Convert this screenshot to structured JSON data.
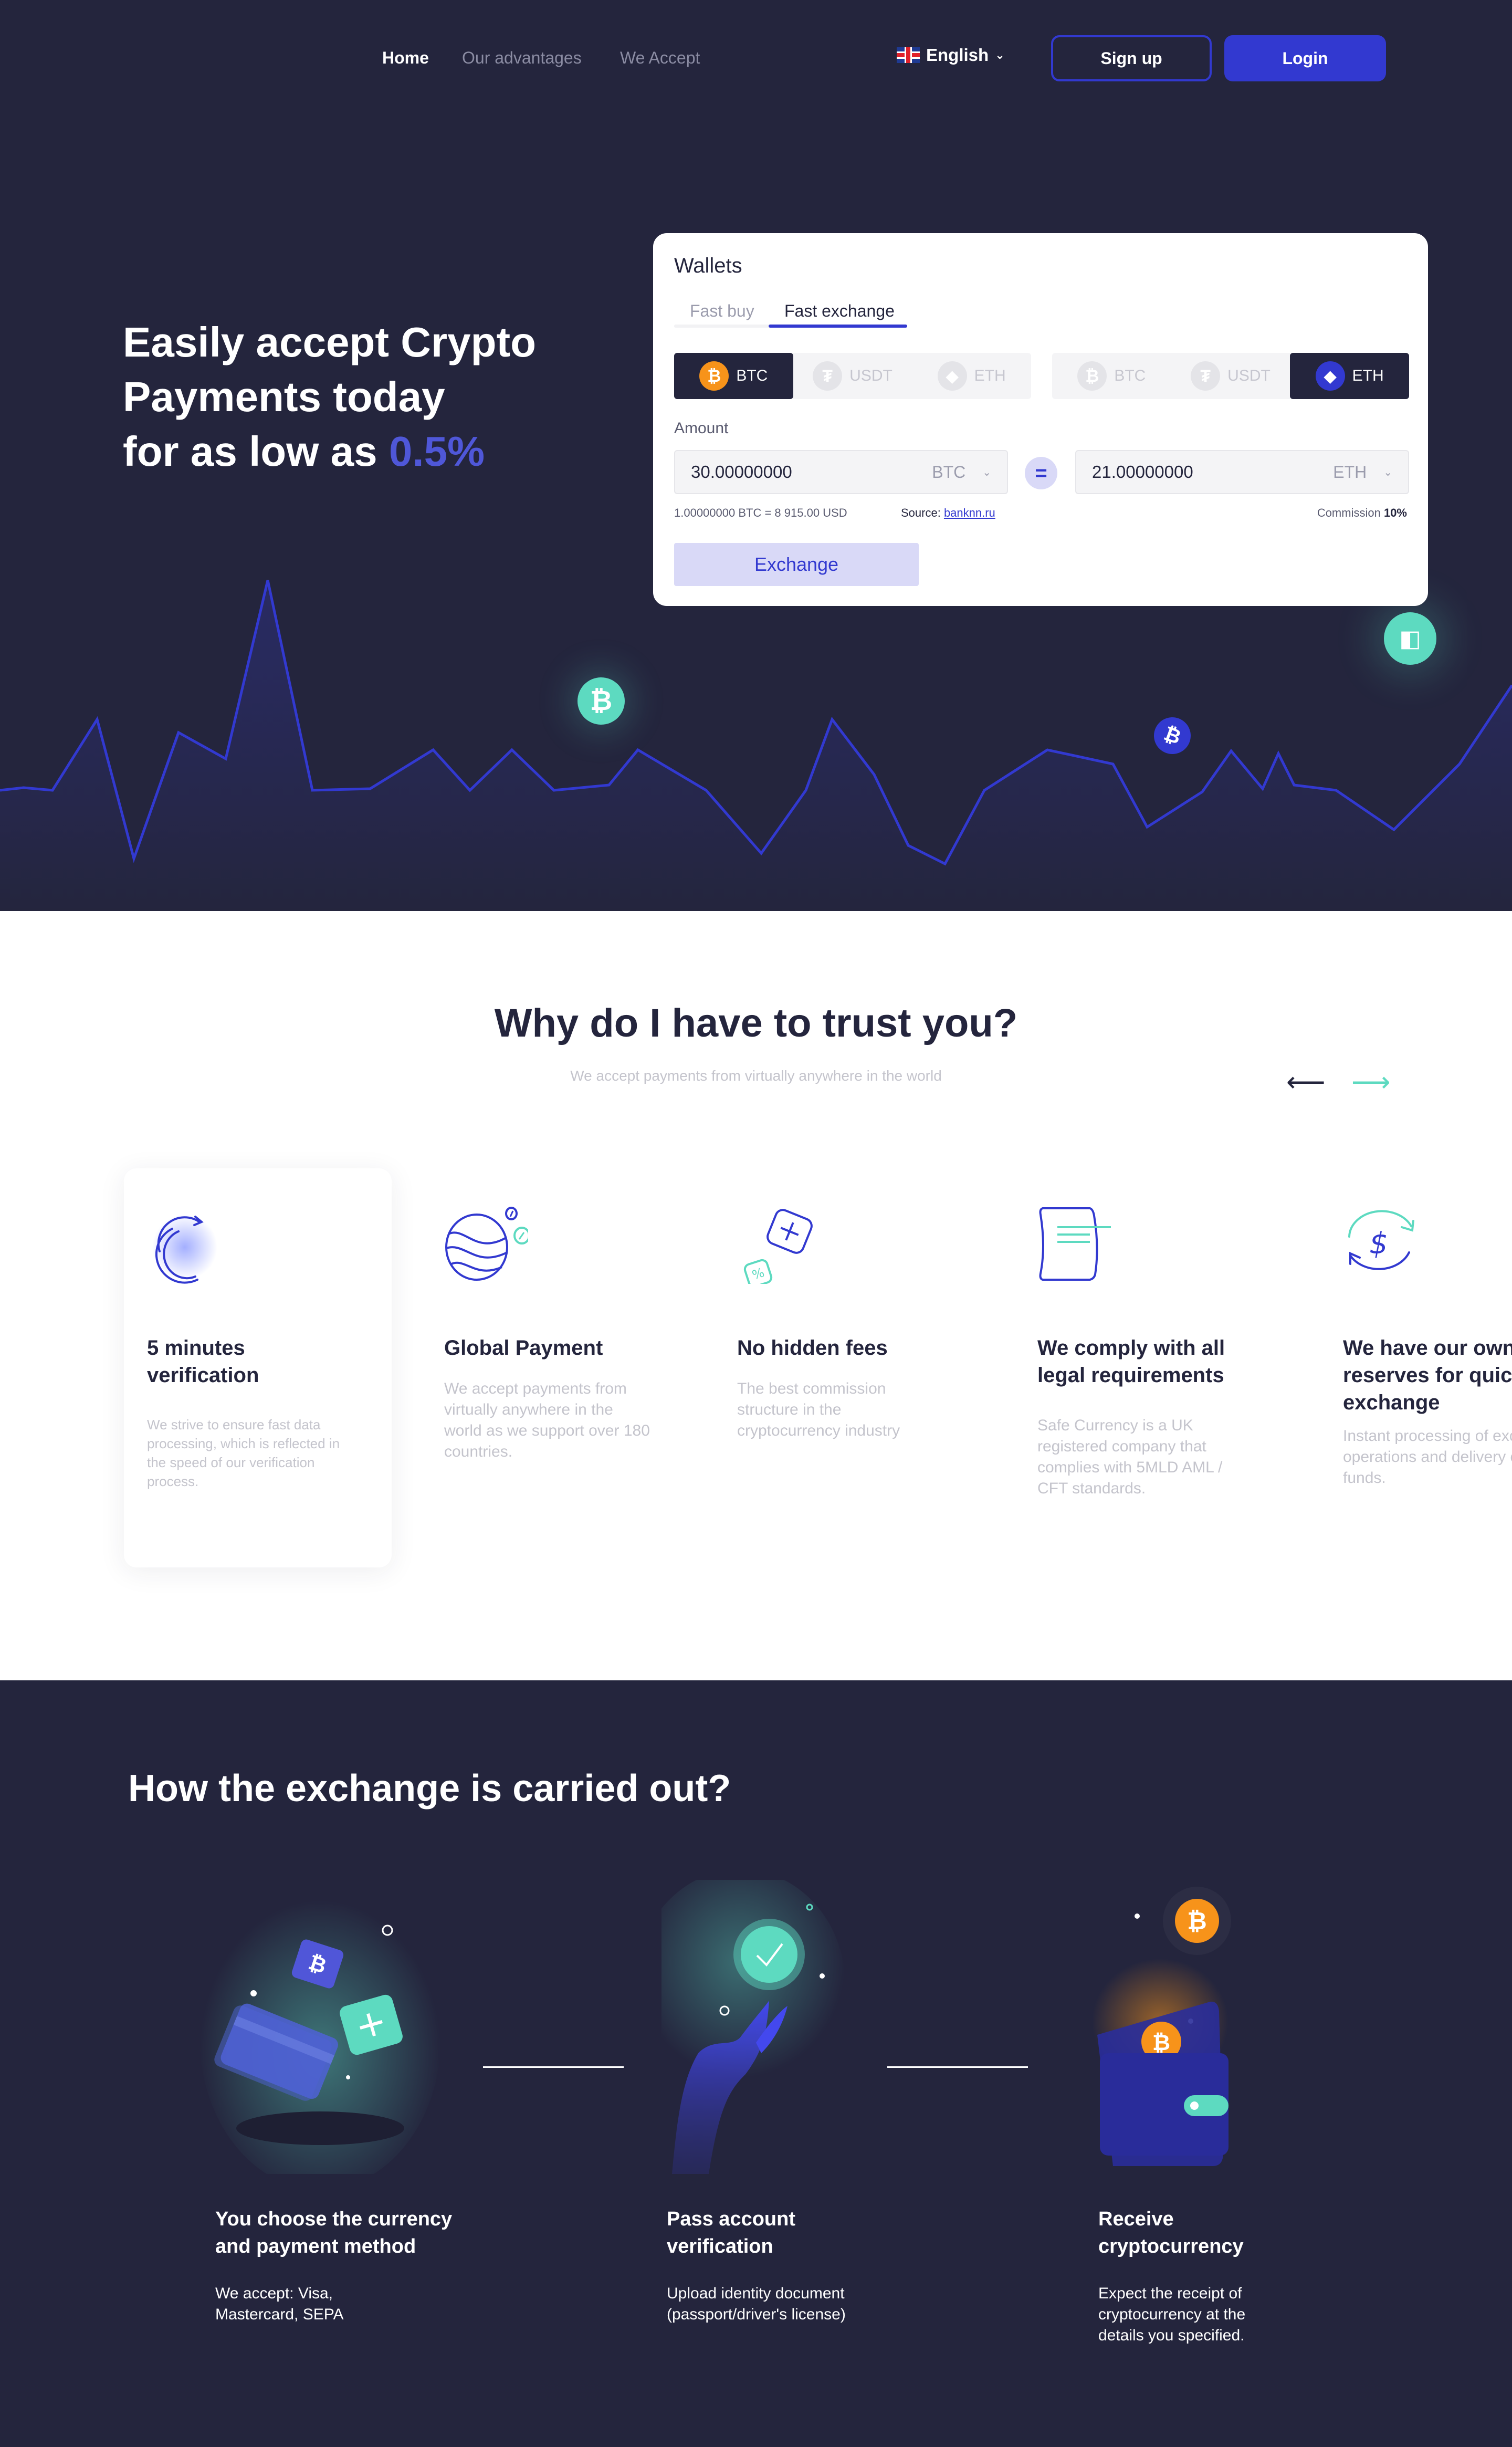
{
  "nav": {
    "links": [
      {
        "label": "Home",
        "active": true
      },
      {
        "label": "Our advantages",
        "active": false
      },
      {
        "label": "We Accept",
        "active": false
      }
    ],
    "language": {
      "label": "English",
      "flag_icon": "uk-flag-icon"
    },
    "signup_label": "Sign up",
    "login_label": "Login"
  },
  "hero": {
    "title_line1": "Easily accept Crypto",
    "title_line2": "Payments today",
    "title_line3_prefix": "for as low as ",
    "title_line3_accent": "0.5%"
  },
  "wallet": {
    "title": "Wallets",
    "tabs": [
      {
        "label": "Fast buy",
        "active": false
      },
      {
        "label": "Fast exchange",
        "active": true
      }
    ],
    "from_currencies": [
      {
        "code": "BTC",
        "icon": "bitcoin-icon",
        "glyph": "₿",
        "selected": true
      },
      {
        "code": "USDT",
        "icon": "tether-icon",
        "glyph": "₮",
        "selected": false
      },
      {
        "code": "ETH",
        "icon": "ethereum-icon",
        "glyph": "◆",
        "selected": false
      }
    ],
    "to_currencies": [
      {
        "code": "BTC",
        "icon": "bitcoin-icon",
        "glyph": "₿",
        "selected": false
      },
      {
        "code": "USDT",
        "icon": "tether-icon",
        "glyph": "₮",
        "selected": false
      },
      {
        "code": "ETH",
        "icon": "ethereum-icon",
        "glyph": "◆",
        "selected": true
      }
    ],
    "amount_label": "Amount",
    "from_amount": "30.00000000",
    "from_unit": "BTC",
    "to_amount": "21.00000000",
    "to_unit": "ETH",
    "equals": "=",
    "rate_text": "1.00000000 BTC =  8 915.00 USD",
    "source_label": "Source: ",
    "source_link": "banknn.ru",
    "commission_label": "Commission ",
    "commission_value": "10%",
    "exchange_label": "Exchange"
  },
  "trust": {
    "title": "Why do I have to trust you?",
    "subtitle": "We accept payments from virtually anywhere in the world",
    "prev_arrow": "⟵",
    "next_arrow": "⟶",
    "features": [
      {
        "title": "5 minutes verification",
        "desc": "We strive to ensure fast data processing, which is reflected in the speed of our verification process."
      },
      {
        "title": "Global Payment",
        "desc": "We accept payments from virtually anywhere in the world as we support over 180 countries."
      },
      {
        "title": "No hidden fees",
        "desc": "The best commission structure in the cryptocurrency industry"
      },
      {
        "title": "We comply with all legal requirements",
        "desc": "Safe Currency is a UK registered company that complies with 5MLD AML / CFT standards."
      },
      {
        "title": "We have our own reserves for quick exchange",
        "desc": "Instant processing of exchange operations and delivery of funds."
      }
    ]
  },
  "how": {
    "title": "How the exchange is carried out?",
    "steps": [
      {
        "title": "You choose the currency and payment method",
        "desc": "We accept: Visa, Mastercard, SEPA"
      },
      {
        "title": "Pass account verification",
        "desc": "Upload identity document (passport/driver's license)"
      },
      {
        "title": "Receive cryptocurrency",
        "desc": "Expect the receipt of cryptocurrency at the details you specified."
      }
    ]
  },
  "colors": {
    "dark_bg": "#24253d",
    "brand_blue": "#3239d0",
    "accent_teal": "#5ddac0",
    "bitcoin_orange": "#f7931a",
    "light_blue": "#d9d9f7"
  }
}
